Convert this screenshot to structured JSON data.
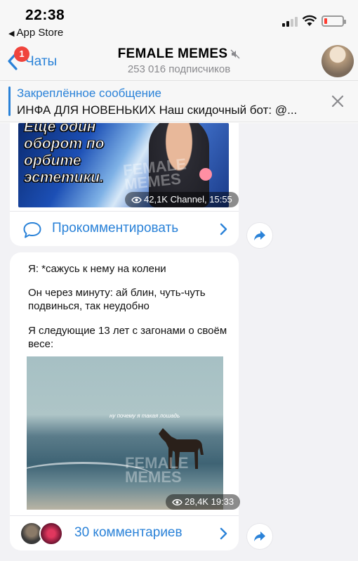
{
  "status_bar": {
    "time": "22:38",
    "back_app": "App Store",
    "battery_color": "#ff3b30"
  },
  "nav": {
    "back_label": "Чаты",
    "unread_badge": "1",
    "title": "FEMALE MEMES",
    "subtitle": "253 016 подписчиков",
    "accent": "#2a82d8",
    "icons": [
      "chevron-left-icon",
      "mute-icon",
      "channel-avatar"
    ]
  },
  "pinned": {
    "title": "Закреплённое сообщение",
    "text": "ИНФА ДЛЯ НОВЕНЬКИХ Наш скидочный бот: @..."
  },
  "posts": [
    {
      "image_text": [
        "Ещё один",
        "оборот по",
        "орбите",
        "эстетики."
      ],
      "watermark": "FEMALE MEMES",
      "views": "42,1K",
      "meta": "Channel, 15:55",
      "comment_label": "Прокомментировать"
    },
    {
      "lines": [
        "Я: *сажусь к нему на колени",
        "Он через минуту: ай блин, чуть-чуть подвинься, так неудобно",
        "Я следующие 13 лет с загонами о своём весе:"
      ],
      "image_caption": "ну почему я такая лошадь",
      "watermark": "FEMALE MEMES",
      "views": "28,4K",
      "time": "19:33",
      "comment_label": "30 комментариев"
    }
  ]
}
